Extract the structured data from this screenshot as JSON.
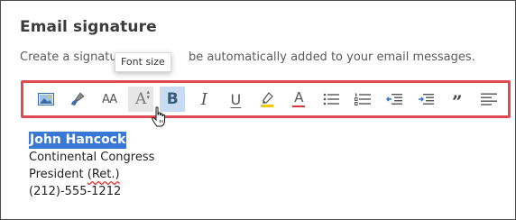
{
  "section": {
    "title": "Email signature",
    "description_prefix": "Create a signatur",
    "description_suffix": "be automatically added to your email messages."
  },
  "tooltip": {
    "text": "Font size"
  },
  "toolbar": {
    "buttons": [
      {
        "name": "insert-picture",
        "icon": "picture-icon"
      },
      {
        "name": "format-painter",
        "icon": "brush-icon"
      },
      {
        "name": "font",
        "icon": "font-icon",
        "label": "AA"
      },
      {
        "name": "font-size",
        "icon": "font-size-icon",
        "label": "A",
        "state": "hover"
      },
      {
        "name": "bold",
        "icon": "bold-icon",
        "label": "B",
        "state": "active"
      },
      {
        "name": "italic",
        "icon": "italic-icon",
        "label": "I"
      },
      {
        "name": "underline",
        "icon": "underline-icon",
        "label": "U"
      },
      {
        "name": "highlight",
        "icon": "highlighter-icon"
      },
      {
        "name": "font-color",
        "icon": "font-color-icon",
        "label": "A"
      },
      {
        "name": "bullets",
        "icon": "bulleted-list-icon"
      },
      {
        "name": "numbering",
        "icon": "numbered-list-icon"
      },
      {
        "name": "decrease-indent",
        "icon": "decrease-indent-icon"
      },
      {
        "name": "increase-indent",
        "icon": "increase-indent-icon"
      },
      {
        "name": "quote",
        "icon": "quote-icon",
        "label": "”"
      },
      {
        "name": "align",
        "icon": "align-icon"
      }
    ],
    "colors": {
      "border": "#e04a52",
      "active_bg": "#c7dcf0",
      "highlighter": "#f2c811",
      "font_color": "#d23b3b"
    }
  },
  "signature": {
    "name": "John Hancock",
    "line1": "Continental Congress",
    "line2_a": "President ",
    "line2_b": "(Ret.)",
    "line3": "(212)-555-1212",
    "selection_color": "#3a78d8"
  }
}
